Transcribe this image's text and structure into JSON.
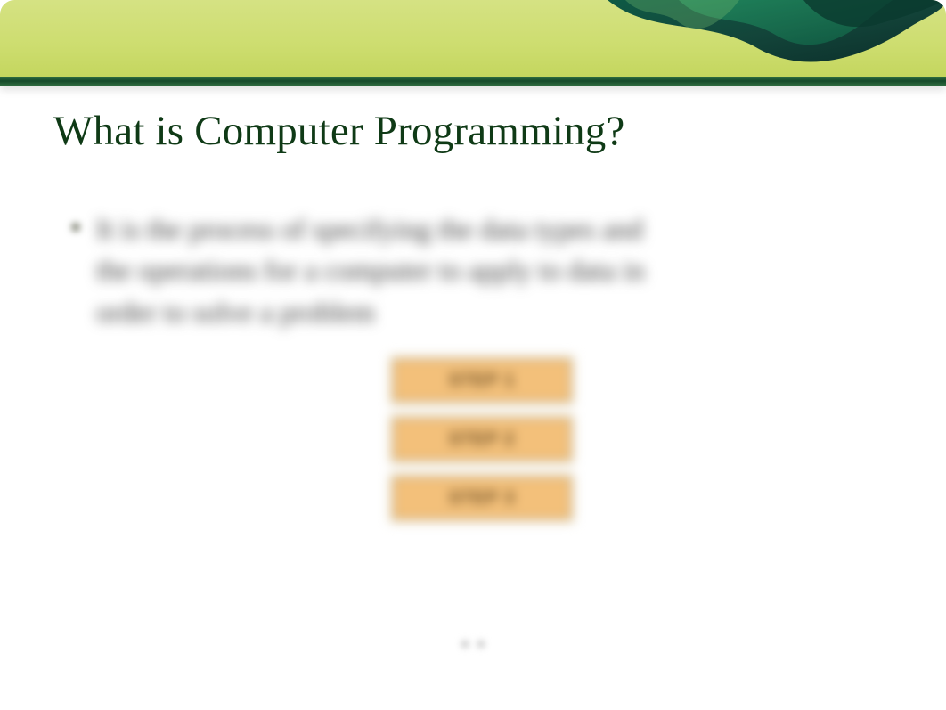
{
  "title": "What is Computer Programming?",
  "bullet": "It is the process of specifying the data types and the operations for a computer to apply to data in order to solve a problem",
  "steps": [
    "STEP 1",
    "STEP 2",
    "STEP 3"
  ]
}
